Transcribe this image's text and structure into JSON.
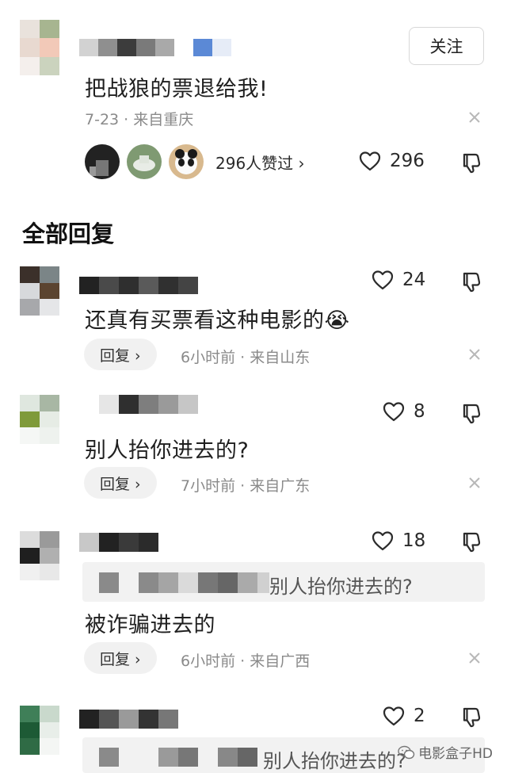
{
  "header_comment": {
    "follow_label": "关注",
    "text": "把战狼的票退给我!",
    "meta": "7-23 · 来自重庆",
    "likers_text": "296人赞过 ›",
    "like_count": "296"
  },
  "section_title": "全部回复",
  "replies": [
    {
      "text": "还真有买票看这种电影的",
      "emoji": "😭",
      "like_count": "24",
      "reply_label": "回复 ›",
      "meta": "6小时前 · 来自山东"
    },
    {
      "text": "别人抬你进去的?",
      "like_count": "8",
      "reply_label": "回复 ›",
      "meta": "7小时前 · 来自广东"
    },
    {
      "quote": "别人抬你进去的?",
      "text": "被诈骗进去的",
      "like_count": "18",
      "reply_label": "回复 ›",
      "meta": "6小时前 · 来自广西"
    },
    {
      "quote": "别人抬你进去的?",
      "like_count": "2"
    }
  ],
  "watermark": "电影盒子HD",
  "icons": {
    "like": "heart-outline-icon",
    "dislike": "thumbs-down-icon",
    "close": "close-icon",
    "watermark": "wechat-icon"
  },
  "colors": {
    "text_primary": "#1f1f1f",
    "text_meta": "#8a8a8a",
    "chip_bg": "#f1f1f1",
    "quote_bg": "#f2f2f2"
  }
}
